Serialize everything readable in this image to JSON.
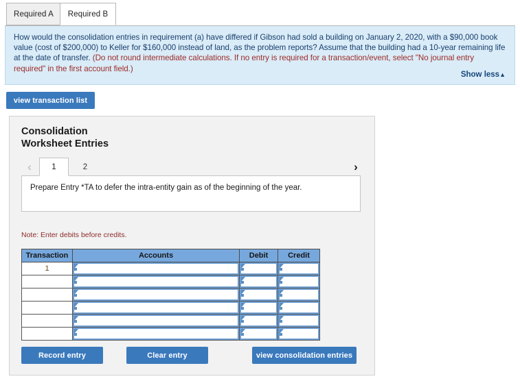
{
  "tabs": [
    {
      "label": "Required A",
      "active": false
    },
    {
      "label": "Required B",
      "active": true
    }
  ],
  "question": {
    "part1": "How would the consolidation entries in requirement (a) have differed if Gibson had sold a building on January 2, 2020, with a $90,000 book value (cost of $200,000) to Keller for $160,000 instead of land, as the problem reports? Assume that the building had a 10-year remaining life at the date of transfer. ",
    "part2_red": "(Do not round intermediate calculations. If no entry is required for a transaction/event, select \"No journal entry required\" in the first account field.)",
    "show_less_label": "Show less",
    "show_less_caret": "▲"
  },
  "toolbar": {
    "view_transaction_list_label": "view transaction list"
  },
  "worksheet": {
    "title_line1": "Consolidation",
    "title_line2": "Worksheet Entries",
    "pager": {
      "prev_icon": "‹",
      "next_icon": "›",
      "pages": [
        {
          "label": "1",
          "active": true
        },
        {
          "label": "2",
          "active": false
        }
      ]
    },
    "prompt": "Prepare Entry *TA to defer the intra-entity gain as of the beginning of the year.",
    "note": "Note: Enter debits before credits.",
    "table": {
      "headers": [
        "Transaction",
        "Accounts",
        "Debit",
        "Credit"
      ],
      "rows": [
        {
          "transaction": "1",
          "accounts": "",
          "debit": "",
          "credit": ""
        },
        {
          "transaction": "",
          "accounts": "",
          "debit": "",
          "credit": ""
        },
        {
          "transaction": "",
          "accounts": "",
          "debit": "",
          "credit": ""
        },
        {
          "transaction": "",
          "accounts": "",
          "debit": "",
          "credit": ""
        },
        {
          "transaction": "",
          "accounts": "",
          "debit": "",
          "credit": ""
        },
        {
          "transaction": "",
          "accounts": "",
          "debit": "",
          "credit": ""
        }
      ]
    },
    "buttons": {
      "record_entry": "Record entry",
      "clear_entry": "Clear entry",
      "view_consolidation_entries": "view consolidation entries"
    }
  },
  "colors": {
    "accent_blue": "#3b79bd",
    "info_panel_bg": "#d9ecf7",
    "table_header_blue": "#77a8dd",
    "note_red": "#8d2b2b",
    "question_blue": "#1c3f6e"
  }
}
